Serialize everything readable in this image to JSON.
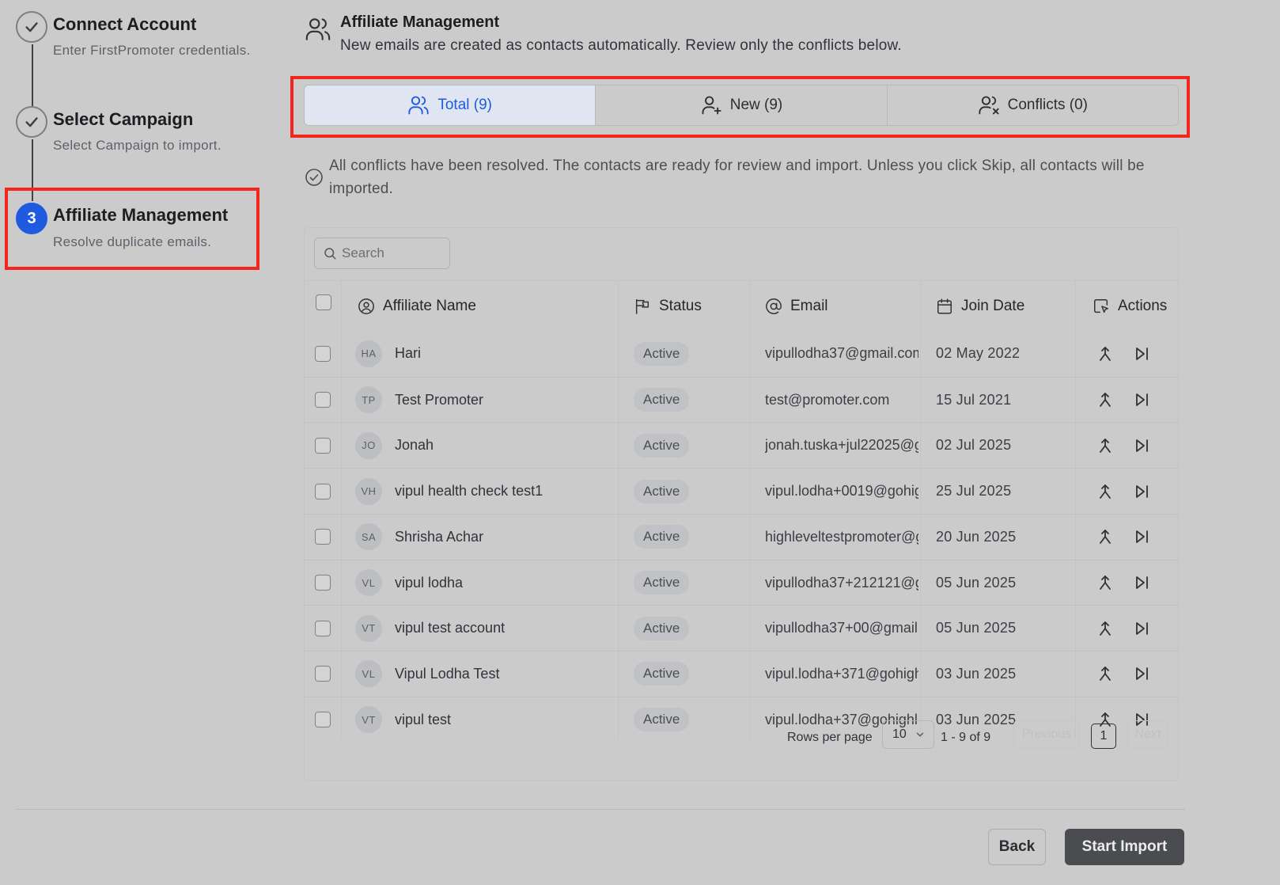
{
  "stepper": {
    "steps": [
      {
        "title": "Connect Account",
        "subtitle": "Enter FirstPromoter credentials.",
        "state": "done"
      },
      {
        "title": "Select Campaign",
        "subtitle": "Select Campaign to import.",
        "state": "done"
      },
      {
        "title": "Affiliate Management",
        "subtitle": "Resolve duplicate emails.",
        "state": "active",
        "number": "3"
      }
    ]
  },
  "header": {
    "title": "Affiliate Management",
    "subtitle": "New emails are created as contacts automatically. Review only the conflicts below."
  },
  "tabs": [
    {
      "label": "Total (9)",
      "icon": "users-icon",
      "active": true
    },
    {
      "label": "New (9)",
      "icon": "user-plus-icon",
      "active": false
    },
    {
      "label": "Conflicts (0)",
      "icon": "user-x-icon",
      "active": false
    }
  ],
  "info": {
    "text": "All conflicts have been resolved. The contacts are ready for review and import. Unless you click Skip, all contacts will be imported."
  },
  "search": {
    "placeholder": "Search"
  },
  "table": {
    "columns": {
      "name": "Affiliate Name",
      "status": "Status",
      "email": "Email",
      "join_date": "Join Date",
      "actions": "Actions"
    },
    "rows": [
      {
        "initials": "HA",
        "name": "Hari",
        "status": "Active",
        "email": "vipullodha37@gmail.com",
        "join_date": "02 May 2022"
      },
      {
        "initials": "TP",
        "name": "Test Promoter",
        "status": "Active",
        "email": "test@promoter.com",
        "join_date": "15 Jul 2021"
      },
      {
        "initials": "JO",
        "name": "Jonah",
        "status": "Active",
        "email": "jonah.tuska+jul22025@g",
        "join_date": "02 Jul 2025"
      },
      {
        "initials": "VH",
        "name": "vipul health check test1",
        "status": "Active",
        "email": "vipul.lodha+0019@gohig",
        "join_date": "25 Jul 2025"
      },
      {
        "initials": "SA",
        "name": "Shrisha Achar",
        "status": "Active",
        "email": "highleveltestpromoter@g",
        "join_date": "20 Jun 2025"
      },
      {
        "initials": "VL",
        "name": "vipul lodha",
        "status": "Active",
        "email": "vipullodha37+212121@gr",
        "join_date": "05 Jun 2025"
      },
      {
        "initials": "VT",
        "name": "vipul test account",
        "status": "Active",
        "email": "vipullodha37+00@gmail.",
        "join_date": "05 Jun 2025"
      },
      {
        "initials": "VL",
        "name": "Vipul Lodha Test",
        "status": "Active",
        "email": "vipul.lodha+371@gohigh",
        "join_date": "03 Jun 2025"
      },
      {
        "initials": "VT",
        "name": "vipul test",
        "status": "Active",
        "email": "vipul.lodha+37@gohighl",
        "join_date": "03 Jun 2025"
      }
    ]
  },
  "pagination": {
    "rows_per_page_label": "Rows per page",
    "rows_per_page": "10",
    "range": "1 - 9 of 9",
    "previous": "Previous",
    "current_page": "1",
    "next": "Next"
  },
  "footer": {
    "back": "Back",
    "start": "Start Import"
  },
  "colors": {
    "accent": "#1f5ae0",
    "highlight": "#f3261e",
    "background": "#cbcbcb"
  }
}
